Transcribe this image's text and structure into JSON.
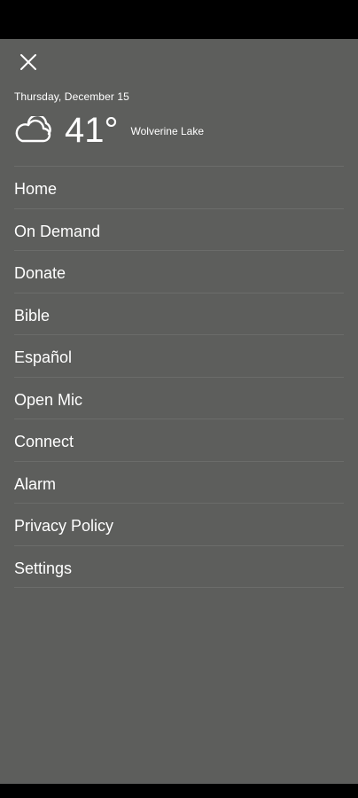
{
  "drawer": {
    "close_icon": "close-icon",
    "date": "Thursday, December 15",
    "weather": {
      "icon": "cloudy-icon",
      "temperature": "41°",
      "location": "Wolverine Lake"
    },
    "menu": [
      {
        "label": "Home"
      },
      {
        "label": "On Demand"
      },
      {
        "label": "Donate"
      },
      {
        "label": "Bible"
      },
      {
        "label": "Español"
      },
      {
        "label": "Open Mic"
      },
      {
        "label": "Connect"
      },
      {
        "label": "Alarm"
      },
      {
        "label": "Privacy Policy"
      },
      {
        "label": "Settings"
      }
    ]
  },
  "colors": {
    "drawer_background": "#5d5e5c",
    "divider": "#6b6c6a",
    "text": "#ffffff"
  }
}
